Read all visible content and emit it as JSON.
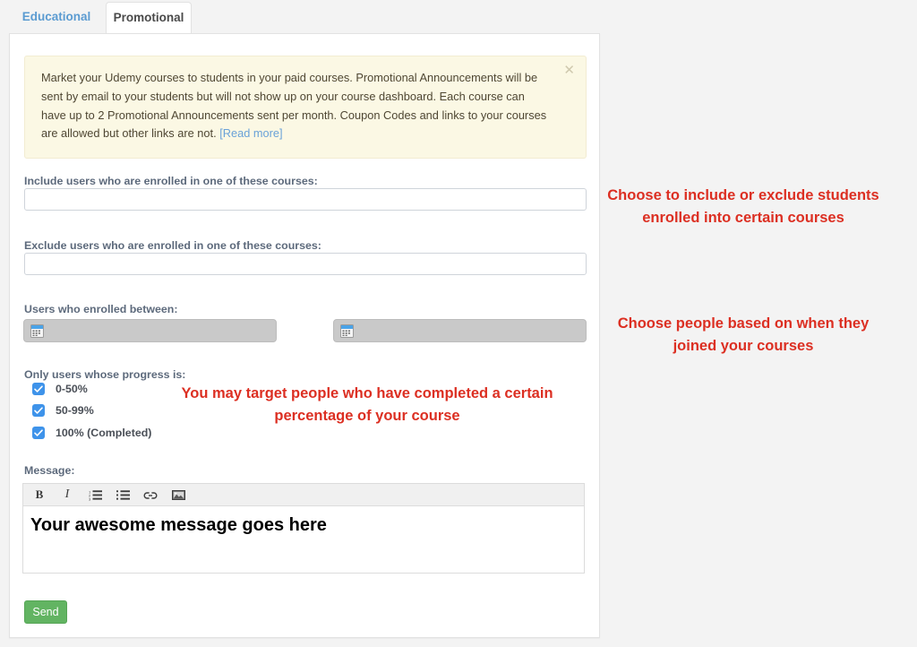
{
  "tabs": [
    {
      "label": "Educational",
      "active": false
    },
    {
      "label": "Promotional",
      "active": true
    }
  ],
  "alert": {
    "text": "Market your Udemy courses to students in your paid courses. Promotional Announcements will be sent by email to your students but will not show up on your course dashboard. Each course can have up to 2 Promotional Announcements sent per month. Coupon Codes and links to your courses are allowed but other links are not. ",
    "link_label": "[Read more]",
    "close_label": "✕",
    "background_color": "#fbf8e4",
    "link_color": "#6aa2d8"
  },
  "form": {
    "include_label": "Include users who are enrolled in one of these courses:",
    "include_value": "",
    "include_placeholder": "",
    "exclude_label": "Exclude users who are enrolled in one of these courses:",
    "exclude_value": "",
    "exclude_placeholder": "",
    "enrolled_between_label": "Users who enrolled between:",
    "date_from_value": "",
    "date_to_value": "",
    "progress_label": "Only users whose progress is:",
    "progress_options": [
      {
        "label": "0-50%",
        "checked": true
      },
      {
        "label": "50-99%",
        "checked": true
      },
      {
        "label": "100% (Completed)",
        "checked": true
      }
    ],
    "message_label": "Message:",
    "message_body": "Your awesome message goes here",
    "send_label": "Send",
    "send_color": "#62b462",
    "checkbox_color": "#3e93ea"
  },
  "editor_toolbar": [
    {
      "name": "bold-icon",
      "label": "B"
    },
    {
      "name": "italic-icon",
      "label": "I"
    },
    {
      "name": "ordered-list-icon",
      "label": ""
    },
    {
      "name": "unordered-list-icon",
      "label": ""
    },
    {
      "name": "link-icon",
      "label": ""
    },
    {
      "name": "image-icon",
      "label": ""
    }
  ],
  "annotations": [
    {
      "text": "Choose to include or exclude students enrolled into certain courses"
    },
    {
      "text": "Choose people based on when they joined your courses"
    },
    {
      "text": "You may target people who have completed a certain percentage of your course"
    }
  ],
  "colors": {
    "page_background": "#f3f3f3",
    "panel_background": "#ffffff",
    "annotation_color": "#dc2f22",
    "tab_inactive_color": "#5b9bd1"
  }
}
